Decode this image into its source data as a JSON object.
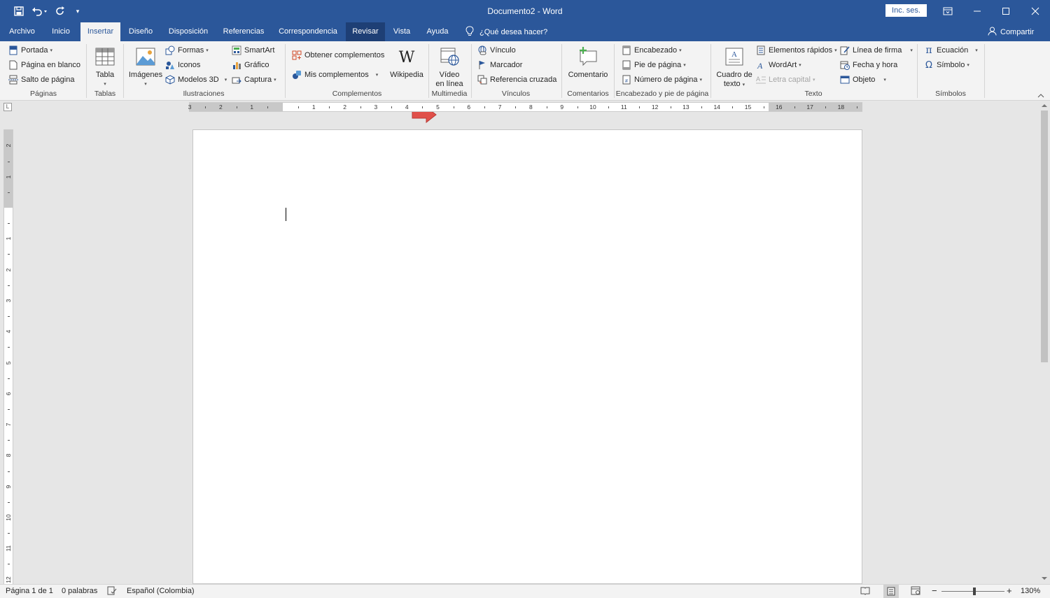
{
  "titlebar": {
    "title": "Documento2 - Word",
    "signin": "Inc. ses.",
    "qat_customize": "▾"
  },
  "tabs": [
    {
      "label": "Archivo"
    },
    {
      "label": "Inicio"
    },
    {
      "label": "Insertar"
    },
    {
      "label": "Diseño"
    },
    {
      "label": "Disposición"
    },
    {
      "label": "Referencias"
    },
    {
      "label": "Correspondencia"
    },
    {
      "label": "Revisar"
    },
    {
      "label": "Vista"
    },
    {
      "label": "Ayuda"
    }
  ],
  "tellme": "¿Qué desea hacer?",
  "share": "Compartir",
  "ribbon": {
    "paginas": {
      "label": "Páginas",
      "portada": "Portada",
      "pagina_blanco": "Página en blanco",
      "salto": "Salto de página"
    },
    "tablas": {
      "label": "Tablas",
      "tabla": "Tabla"
    },
    "ilustraciones": {
      "label": "Ilustraciones",
      "imagenes": "Imágenes",
      "formas": "Formas",
      "iconos": "Iconos",
      "modelos3d": "Modelos 3D",
      "smartart": "SmartArt",
      "grafico": "Gráfico",
      "captura": "Captura"
    },
    "complementos": {
      "label": "Complementos",
      "obtener": "Obtener complementos",
      "mis": "Mis complementos",
      "wikipedia": "Wikipedia",
      "wiki_glyph": "W"
    },
    "multimedia": {
      "label": "Multimedia",
      "video_l1": "Vídeo",
      "video_l2": "en línea"
    },
    "vinculos": {
      "label": "Vínculos",
      "vinculo": "Vínculo",
      "marcador": "Marcador",
      "ref_cruzada": "Referencia cruzada"
    },
    "comentarios": {
      "label": "Comentarios",
      "comentario": "Comentario"
    },
    "encabezado": {
      "label": "Encabezado y pie de página",
      "encabezado": "Encabezado",
      "pie": "Pie de página",
      "numero": "Número de página"
    },
    "texto": {
      "label": "Texto",
      "cuadro_l1": "Cuadro de",
      "cuadro_l2": "texto",
      "elementos": "Elementos rápidos",
      "wordart": "WordArt",
      "letra_capital": "Letra capital",
      "linea_firma": "Línea de firma",
      "fecha_hora": "Fecha y hora",
      "objeto": "Objeto"
    },
    "simbolos": {
      "label": "Símbolos",
      "ecuacion": "Ecuación",
      "simbolo": "Símbolo"
    }
  },
  "ruler": {
    "corner": "L",
    "h_left": [
      "3",
      "2",
      "1"
    ],
    "h_right": [
      "1",
      "2",
      "3",
      "4",
      "5",
      "6",
      "7",
      "8",
      "9",
      "10",
      "11",
      "12",
      "13",
      "14",
      "15",
      "16",
      "17",
      "18"
    ],
    "v_top": [
      "2",
      "1"
    ],
    "v_bottom": [
      "1",
      "2",
      "3",
      "4",
      "5",
      "6",
      "7",
      "8",
      "9",
      "10",
      "11",
      "12"
    ]
  },
  "status": {
    "page": "Página 1 de 1",
    "words": "0 palabras",
    "language": "Español (Colombia)",
    "zoom": "130%",
    "zoom_minus": "−",
    "zoom_plus": "+"
  },
  "colors": {
    "accent": "#2b579a",
    "arrow": "#e0504a"
  }
}
